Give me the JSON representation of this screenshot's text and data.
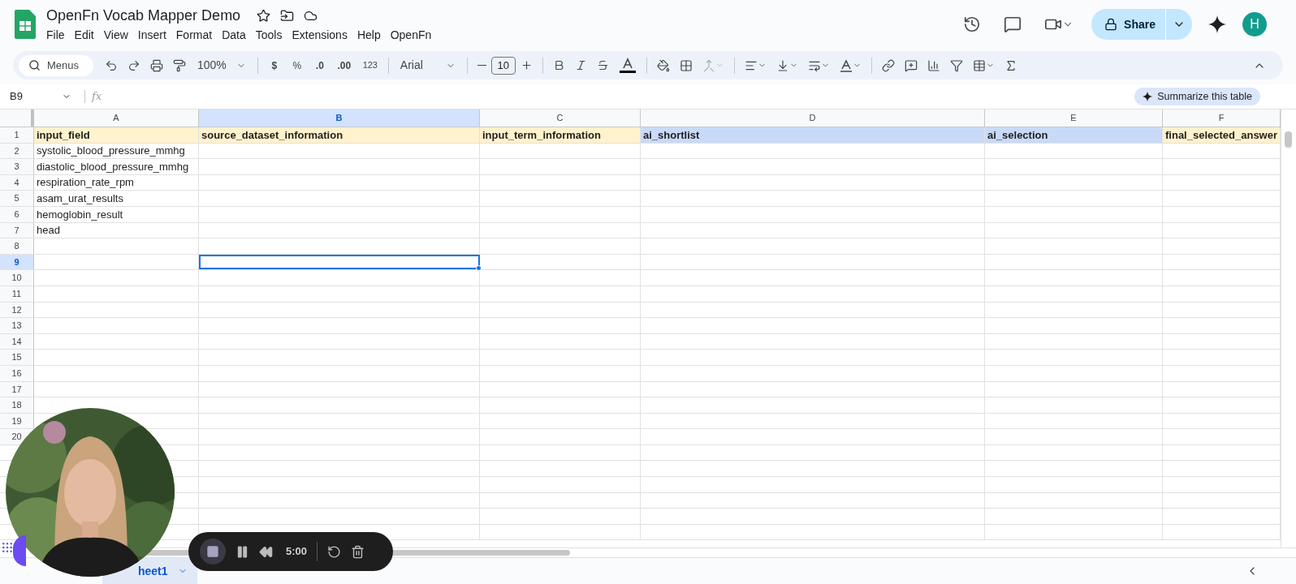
{
  "document": {
    "title": "OpenFn Vocab Mapper Demo",
    "menus": [
      "File",
      "Edit",
      "View",
      "Insert",
      "Format",
      "Data",
      "Tools",
      "Extensions",
      "Help",
      "OpenFn"
    ]
  },
  "header_actions": {
    "share": "Share",
    "avatar": "H"
  },
  "toolbar": {
    "search_placeholder": "Menus",
    "zoom": "100%",
    "currency": "$",
    "percent": "%",
    "decrease_decimal": ".0",
    "increase_decimal": ".00",
    "number_format": "123",
    "font": "Arial",
    "font_size": "10"
  },
  "formula_bar": {
    "cell_ref": "B9",
    "fx_label": "fx"
  },
  "summarize_button": "Summarize this table",
  "columns": [
    {
      "letter": "A",
      "selected": false
    },
    {
      "letter": "B",
      "selected": true
    },
    {
      "letter": "C",
      "selected": false
    },
    {
      "letter": "D",
      "selected": false
    },
    {
      "letter": "E",
      "selected": false
    },
    {
      "letter": "F",
      "selected": false
    }
  ],
  "header_row": {
    "number": "1",
    "selected": false,
    "cells": [
      {
        "text": "input_field",
        "color": "#fff2cc"
      },
      {
        "text": "source_dataset_information",
        "color": "#fff2cc"
      },
      {
        "text": "input_term_information",
        "color": "#fff2cc"
      },
      {
        "text": "ai_shortlist",
        "color": "#c9daf8"
      },
      {
        "text": "ai_selection",
        "color": "#c9daf8"
      },
      {
        "text": "final_selected_answer",
        "color": "#fff2cc"
      }
    ]
  },
  "rows": [
    {
      "number": "2",
      "selected": false,
      "cells": [
        "systolic_blood_pressure_mmhg"
      ]
    },
    {
      "number": "3",
      "selected": false,
      "cells": [
        "diastolic_blood_pressure_mmhg"
      ]
    },
    {
      "number": "4",
      "selected": false,
      "cells": [
        "respiration_rate_rpm"
      ]
    },
    {
      "number": "5",
      "selected": false,
      "cells": [
        "asam_urat_results"
      ]
    },
    {
      "number": "6",
      "selected": false,
      "cells": [
        "hemoglobin_result"
      ]
    },
    {
      "number": "7",
      "selected": false,
      "cells": [
        "head"
      ]
    },
    {
      "number": "8",
      "selected": false
    },
    {
      "number": "9",
      "selected": true
    },
    {
      "number": "10",
      "selected": false
    },
    {
      "number": "11",
      "selected": false
    },
    {
      "number": "12",
      "selected": false
    },
    {
      "number": "13",
      "selected": false
    },
    {
      "number": "14",
      "selected": false
    },
    {
      "number": "15",
      "selected": false
    },
    {
      "number": "16",
      "selected": false
    },
    {
      "number": "17",
      "selected": false
    },
    {
      "number": "18",
      "selected": false
    },
    {
      "number": "19",
      "selected": false
    },
    {
      "number": "20",
      "selected": false
    }
  ],
  "sheet_tabs": [
    {
      "label": "heet1",
      "selected": true
    }
  ],
  "recorder": {
    "time": "5:00"
  }
}
